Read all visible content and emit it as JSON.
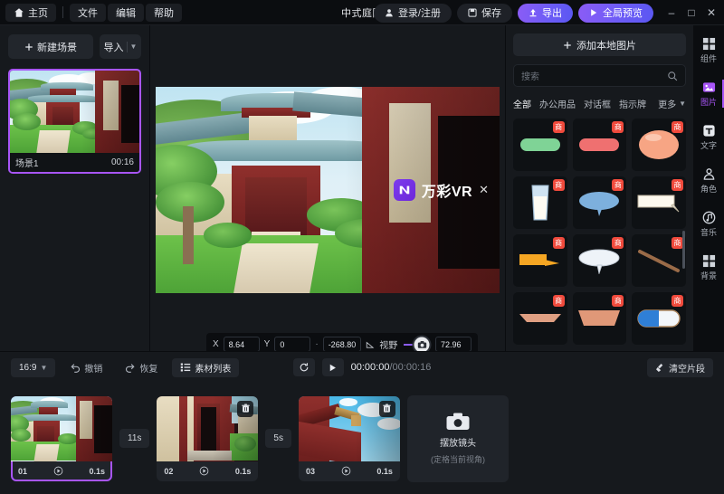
{
  "titlebar": {
    "home_label": "主页",
    "menus": [
      "文件",
      "编辑",
      "帮助"
    ],
    "doc_title": "中式庭院",
    "login_label": "登录/注册",
    "save_label": "保存",
    "export_label": "导出",
    "preview_label": "全局预览",
    "window_minimize": "–",
    "window_maximize": "□",
    "window_close": "✕",
    "accent": "#8b5cf6"
  },
  "scene_panel": {
    "new_scene_label": "新建场景",
    "import_label": "导入",
    "scenes": [
      {
        "name": "场景1",
        "duration": "00:16",
        "selected": true
      }
    ],
    "selection_color": "#a855f7"
  },
  "stage": {
    "watermark": {
      "brand": "万彩VR",
      "close": "✕",
      "logo_color": "#7c3aed"
    },
    "viewbar": {
      "x_label": "X",
      "x_value": "8.64",
      "y_label": "Y",
      "y_value": "0",
      "dot": "·",
      "z_value": "-268.80",
      "fov_label": "视野",
      "fov_value": "72.96",
      "slider_percent": 72
    }
  },
  "asset_panel": {
    "add_local_label": "添加本地图片",
    "search_placeholder": "搜索",
    "tabs": [
      {
        "label": "全部",
        "active": true
      },
      {
        "label": "办公用品",
        "active": false
      },
      {
        "label": "对话框",
        "active": false
      },
      {
        "label": "指示牌",
        "active": false
      }
    ],
    "more_label": "更多",
    "badge_text": "商",
    "items": [
      {
        "name": "green-rounded-bar",
        "badge": "商"
      },
      {
        "name": "red-rounded-bar",
        "badge": "商"
      },
      {
        "name": "peach-ellipse-balloon",
        "badge": "商"
      },
      {
        "name": "glass-of-milk",
        "badge": "商"
      },
      {
        "name": "blue-speech-ellipse",
        "badge": "商"
      },
      {
        "name": "white-rect-callout",
        "badge": "商"
      },
      {
        "name": "orange-tag-callout",
        "badge": "商"
      },
      {
        "name": "white-speech-ellipse",
        "badge": "商"
      },
      {
        "name": "wooden-stick",
        "badge": "商"
      },
      {
        "name": "thin-tan-plank",
        "badge": "商"
      },
      {
        "name": "thick-tan-plank",
        "badge": "商"
      },
      {
        "name": "blue-white-capsule",
        "badge": "商"
      }
    ]
  },
  "rail": {
    "items": [
      {
        "label": "组件",
        "icon": "components-icon",
        "active": false
      },
      {
        "label": "图片",
        "icon": "image-icon",
        "active": true
      },
      {
        "label": "文字",
        "icon": "text-icon",
        "active": false
      },
      {
        "label": "角色",
        "icon": "character-icon",
        "active": false
      },
      {
        "label": "音乐",
        "icon": "music-icon",
        "active": false
      },
      {
        "label": "背景",
        "icon": "background-icon",
        "active": false
      }
    ]
  },
  "timeline": {
    "ratio_label": "16:9",
    "undo_label": "撤销",
    "redo_label": "恢复",
    "asset_list_label": "素材列表",
    "clear_label": "清空片段",
    "current_time": "00:00:00",
    "total_time": "00:00:16",
    "time_separator": "/",
    "loop_icon": "loop-icon",
    "play_icon": "play-icon",
    "clips": [
      {
        "index": "01",
        "duration": "0.1s",
        "selected": true,
        "has_delete": false
      },
      {
        "index": "02",
        "duration": "0.1s",
        "selected": false,
        "has_delete": true
      },
      {
        "index": "03",
        "duration": "0.1s",
        "selected": false,
        "has_delete": true
      }
    ],
    "gaps": [
      "11s",
      "5s"
    ],
    "add_clip": {
      "title": "摆放镜头",
      "subtitle": "(定格当前视角)"
    }
  }
}
